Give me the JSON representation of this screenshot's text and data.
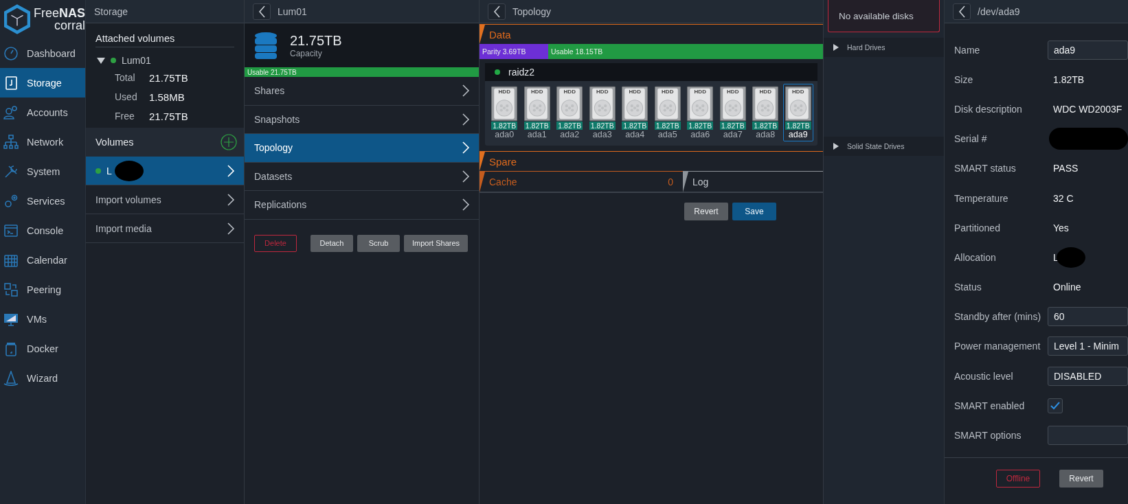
{
  "sidebar": {
    "logo": {
      "line1": "Free**NAS**",
      "line2": "corral"
    },
    "items": [
      {
        "label": "Dashboard",
        "selected": false
      },
      {
        "label": "Storage",
        "selected": true
      },
      {
        "label": "Accounts",
        "selected": false
      },
      {
        "label": "Network",
        "selected": false
      },
      {
        "label": "System",
        "selected": false
      },
      {
        "label": "Services",
        "selected": false
      },
      {
        "label": "Console",
        "selected": false
      },
      {
        "label": "Calendar",
        "selected": false
      },
      {
        "label": "Peering",
        "selected": false
      },
      {
        "label": "VMs",
        "selected": false
      },
      {
        "label": "Docker",
        "selected": false
      },
      {
        "label": "Wizard",
        "selected": false
      }
    ]
  },
  "storage_panel": {
    "title": "Storage",
    "attached_title": "Attached volumes",
    "volume": {
      "name": "Lum01",
      "expanded": true,
      "color": "#2ea043"
    },
    "stats": [
      {
        "label": "Total",
        "value": "21.75TB"
      },
      {
        "label": "Used",
        "value": "1.58MB"
      },
      {
        "label": "Free",
        "value": "21.75TB"
      }
    ],
    "volumes_title": "Volumes",
    "items": [
      {
        "kind": "volume",
        "label": "L",
        "selected": true,
        "color": "#2ea043",
        "redacted": true
      },
      {
        "kind": "action",
        "label": "Import volumes",
        "selected": false
      },
      {
        "kind": "action",
        "label": "Import media",
        "selected": false
      }
    ]
  },
  "volume_panel": {
    "title": "Lum01",
    "capacity": "21.75TB",
    "capacity_label": "Capacity",
    "usable_bar": {
      "label": "Usable 21.75TB",
      "level": 1
    },
    "menu": [
      {
        "label": "Shares",
        "selected": false
      },
      {
        "label": "Snapshots",
        "selected": false
      },
      {
        "label": "Topology",
        "selected": true
      },
      {
        "label": "Datasets",
        "selected": false
      },
      {
        "label": "Replications",
        "selected": false
      }
    ],
    "buttons": [
      {
        "label": "Delete",
        "kind": "danger"
      },
      {
        "label": "Detach",
        "kind": "default"
      },
      {
        "label": "Scrub",
        "kind": "default"
      },
      {
        "label": "Import Shares",
        "kind": "default"
      }
    ]
  },
  "topology": {
    "title": "Topology",
    "data": {
      "title": "Data",
      "segments": [
        {
          "label": "Parity 3.69TB",
          "level": 0.2,
          "color": "#6d2fd6"
        },
        {
          "label": "Usable 18.15TB",
          "level": 0.8,
          "color": "#219a43"
        }
      ]
    },
    "vdev": {
      "name": "raidz2",
      "color": "#22a845",
      "disks": [
        {
          "type": "HDD",
          "size": "1.82TB",
          "name": "ada0",
          "selected": false
        },
        {
          "type": "HDD",
          "size": "1.82TB",
          "name": "ada1",
          "selected": false
        },
        {
          "type": "HDD",
          "size": "1.82TB",
          "name": "ada2",
          "selected": false
        },
        {
          "type": "HDD",
          "size": "1.82TB",
          "name": "ada3",
          "selected": false
        },
        {
          "type": "HDD",
          "size": "1.82TB",
          "name": "ada4",
          "selected": false
        },
        {
          "type": "HDD",
          "size": "1.82TB",
          "name": "ada5",
          "selected": false
        },
        {
          "type": "HDD",
          "size": "1.82TB",
          "name": "ada6",
          "selected": false
        },
        {
          "type": "HDD",
          "size": "1.82TB",
          "name": "ada7",
          "selected": false
        },
        {
          "type": "HDD",
          "size": "1.82TB",
          "name": "ada8",
          "selected": false
        },
        {
          "type": "HDD",
          "size": "1.82TB",
          "name": "ada9",
          "selected": true
        }
      ]
    },
    "spare": {
      "title": "Spare"
    },
    "cache": {
      "title": "Cache",
      "count": "0"
    },
    "log": {
      "title": "Log"
    },
    "buttons": [
      {
        "label": "Revert",
        "kind": "default"
      },
      {
        "label": "Save",
        "kind": "primary"
      }
    ]
  },
  "disks_panel": {
    "empty_message": "No available disks",
    "groups": [
      {
        "label": "Hard Drives",
        "expanded": false
      },
      {
        "label": "Solid State Drives",
        "expanded": false
      }
    ]
  },
  "detail": {
    "title": "/dev/ada9",
    "fields": [
      {
        "label": "Name",
        "kind": "input",
        "value": "ada9"
      },
      {
        "label": "Size",
        "kind": "text",
        "value": "1.82TB"
      },
      {
        "label": "Disk description",
        "kind": "text",
        "value": "WDC WD2003F"
      },
      {
        "label": "Serial #",
        "kind": "redacted"
      },
      {
        "label": "SMART status",
        "kind": "text",
        "value": "PASS"
      },
      {
        "label": "Temperature",
        "kind": "text",
        "value": "32 C"
      },
      {
        "label": "Partitioned",
        "kind": "text",
        "value": "Yes"
      },
      {
        "label": "Allocation",
        "kind": "redacted",
        "value": "L"
      },
      {
        "label": "Status",
        "kind": "text",
        "value": "Online"
      },
      {
        "label": "Standby after (mins)",
        "kind": "input",
        "value": "60"
      },
      {
        "label": "Power management",
        "kind": "select",
        "value": "Level 1 - Minim"
      },
      {
        "label": "Acoustic level",
        "kind": "select",
        "value": "DISABLED"
      },
      {
        "label": "SMART enabled",
        "kind": "checkbox",
        "checked": true
      },
      {
        "label": "SMART options",
        "kind": "input"
      }
    ],
    "buttons": [
      {
        "label": "Offline",
        "kind": "danger"
      },
      {
        "label": "Revert",
        "kind": "default"
      }
    ]
  }
}
